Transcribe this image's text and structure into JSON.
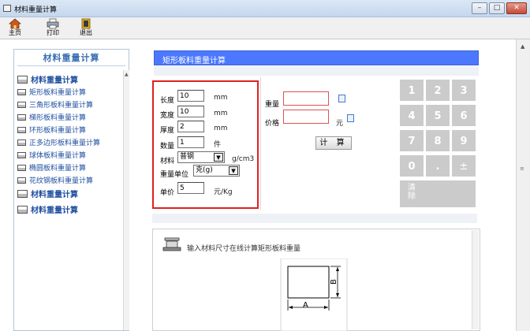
{
  "window": {
    "title": "材料重量计算",
    "buttons": [
      "–",
      "□",
      "✕"
    ]
  },
  "toolbar": {
    "items": [
      {
        "label": "主页",
        "icon": "home-icon"
      },
      {
        "label": "打印",
        "icon": "printer-icon"
      },
      {
        "label": "退出",
        "icon": "exit-icon"
      }
    ]
  },
  "sidebar": {
    "title": "材料重量计算",
    "items": [
      {
        "label": "材料重量计算",
        "bold": true
      },
      {
        "label": "矩形板料重量计算",
        "bold": false
      },
      {
        "label": "三角形板料重量计算",
        "bold": false
      },
      {
        "label": "梯形板料重量计算",
        "bold": false
      },
      {
        "label": "环形板料重量计算",
        "bold": false
      },
      {
        "label": "正多边形板料重量计算",
        "bold": false
      },
      {
        "label": "球体板料重量计算",
        "bold": false
      },
      {
        "label": "椭圆板料重量计算",
        "bold": false
      },
      {
        "label": "花纹钢板料重量计算",
        "bold": false
      },
      {
        "label": "材料重量计算",
        "bold": true
      },
      {
        "label": "材料重量计算",
        "bold": true
      }
    ]
  },
  "main": {
    "header": "矩形板料重量计算",
    "inputs": {
      "length": {
        "label": "长度",
        "value": "10",
        "unit": "mm"
      },
      "width": {
        "label": "宽度",
        "value": "10",
        "unit": "mm"
      },
      "thickness": {
        "label": "厚度",
        "value": "2",
        "unit": "mm"
      },
      "quantity": {
        "label": "数量",
        "value": "1",
        "unit": "件"
      },
      "material": {
        "label": "材料",
        "value": "普钢",
        "unit": "g/cm3"
      },
      "weight_unit": {
        "label": "重量单位",
        "value": "克(g)"
      },
      "unit_price": {
        "label": "单价",
        "value": "5",
        "unit": "元/Kg"
      }
    },
    "results": {
      "weight": {
        "label": "重量",
        "value": ""
      },
      "price": {
        "label": "价格",
        "value": "",
        "unit": "元"
      }
    },
    "calc_label": "计 算",
    "keypad": {
      "keys": [
        "1",
        "2",
        "3",
        "4",
        "5",
        "6",
        "7",
        "8",
        "9",
        "0",
        ".",
        "±"
      ],
      "clear_label_1": "清",
      "clear_label_2": "除"
    },
    "info": {
      "text": "输入材料尺寸在线计算矩形板料重量",
      "dim_a": "A",
      "dim_b": "B"
    }
  },
  "colors": {
    "header_blue": "#4b78ff",
    "highlight_red": "#e02020",
    "link_blue": "#1f4fa0",
    "key_gray": "#cbcbcb"
  }
}
